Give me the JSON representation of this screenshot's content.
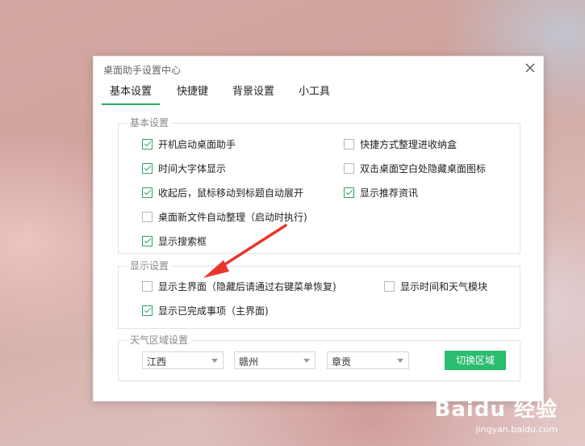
{
  "window": {
    "title": "桌面助手设置中心"
  },
  "tabs": [
    {
      "label": "基本设置",
      "active": true
    },
    {
      "label": "快捷键",
      "active": false
    },
    {
      "label": "背景设置",
      "active": false
    },
    {
      "label": "小工具",
      "active": false
    }
  ],
  "basic": {
    "legend": "基本设置",
    "options": [
      {
        "label": "开机启动桌面助手",
        "checked": true
      },
      {
        "label": "快捷方式整理进收纳盒",
        "checked": false
      },
      {
        "label": "时间大字体显示",
        "checked": true
      },
      {
        "label": "双击桌面空白处隐藏桌面图标",
        "checked": false
      },
      {
        "label": "收起后，鼠标移动到标题自动展开",
        "checked": true
      },
      {
        "label": "显示推荐资讯",
        "checked": true
      },
      {
        "label": "桌面新文件自动整理（启动时执行)",
        "checked": false
      },
      {
        "label": "显示搜索框",
        "checked": true
      }
    ]
  },
  "display": {
    "legend": "显示设置",
    "options": [
      {
        "label": "显示主界面（隐藏后请通过右键菜单恢复)",
        "checked": false
      },
      {
        "label": "显示时间和天气模块",
        "checked": false
      },
      {
        "label": "显示已完成事项（主界面)",
        "checked": true
      }
    ]
  },
  "weather": {
    "legend": "天气区域设置",
    "province": "江西",
    "city": "赣州",
    "county": "章贡",
    "switch_label": "切换区域"
  },
  "watermark": {
    "brand": "Baidu 经验",
    "url": "jingyan.baidu.com"
  },
  "colors": {
    "accent": "#2aa865",
    "button": "#2bbd6e",
    "arrow": "#e8362c"
  }
}
